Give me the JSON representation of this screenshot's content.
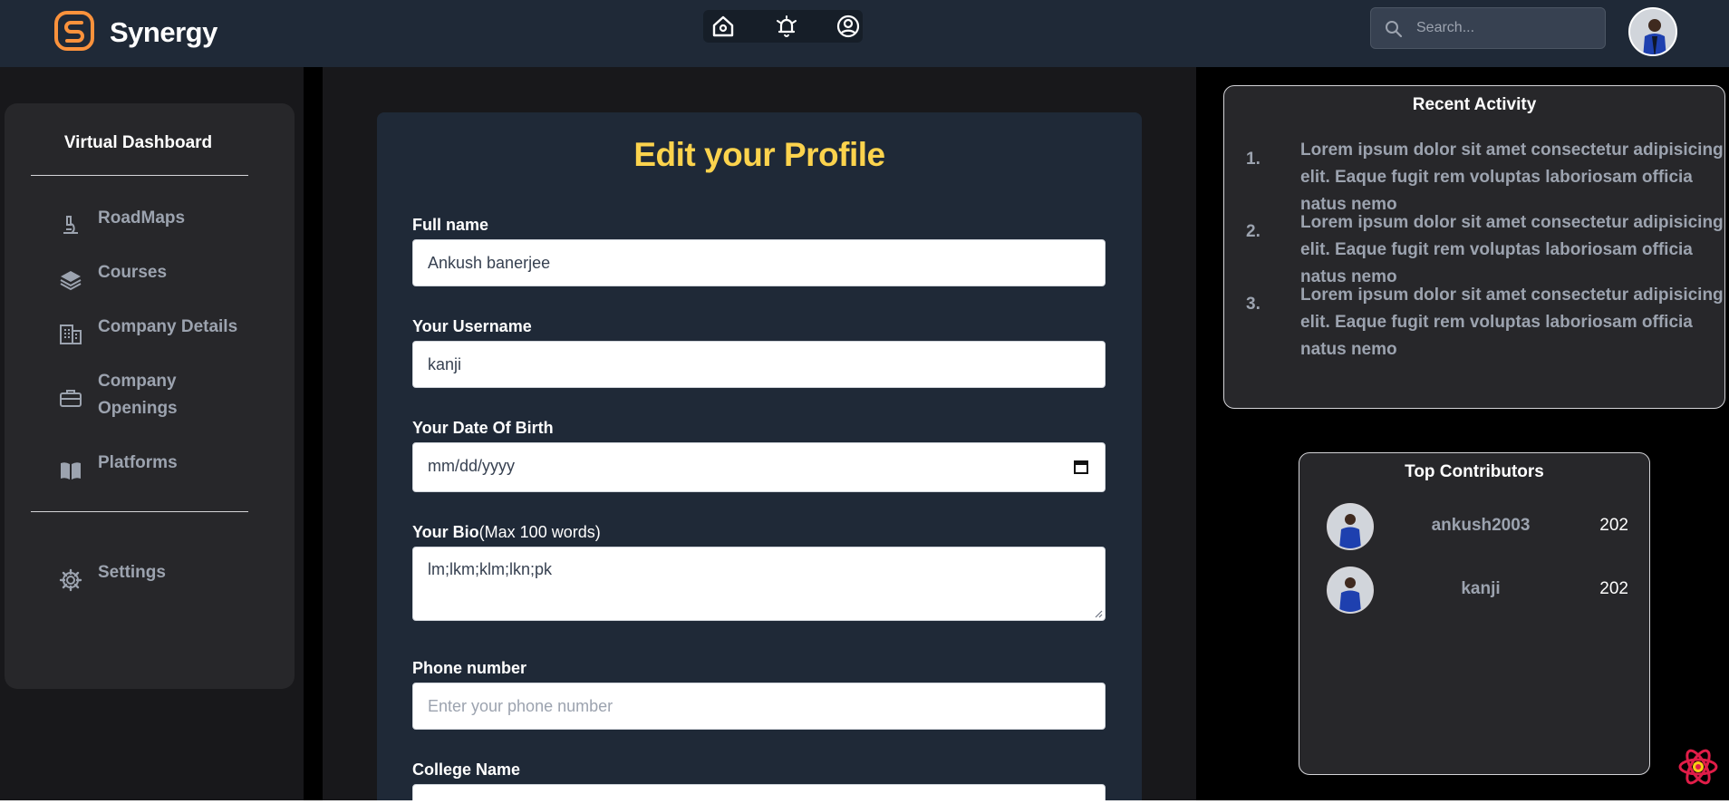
{
  "header": {
    "brand": "Synergy",
    "search_placeholder": "Search...",
    "nav": [
      "home-icon",
      "bell-icon",
      "user-icon"
    ]
  },
  "sidebar": {
    "title": "Virtual Dashboard",
    "items": [
      {
        "label": "RoadMaps",
        "icon": "microscope-icon"
      },
      {
        "label": "Courses",
        "icon": "layers-icon"
      },
      {
        "label": "Company Details",
        "icon": "building-icon"
      },
      {
        "label": "Company Openings",
        "icon": "briefcase-icon"
      },
      {
        "label": "Platforms",
        "icon": "book-icon"
      }
    ],
    "settings_label": "Settings"
  },
  "form": {
    "title": "Edit your Profile",
    "full_name_label": "Full name",
    "full_name_value": "Ankush banerjee",
    "username_label": "Your Username",
    "username_value": "kanji",
    "dob_label": "Your Date Of Birth",
    "dob_placeholder": "mm/dd/yyyy",
    "bio_label": "Your Bio",
    "bio_hint": "(Max 100 words)",
    "bio_value": "lm;lkm;klm;lkn;pk",
    "phone_label": "Phone number",
    "phone_placeholder": "Enter your phone number",
    "college_label": "College Name"
  },
  "recent_activity": {
    "title": "Recent Activity",
    "items": [
      {
        "num": "1.",
        "text": "Lorem ipsum dolor sit amet consectetur adipisicing elit. Eaque fugit rem voluptas laboriosam officia natus nemo"
      },
      {
        "num": "2.",
        "text": "Lorem ipsum dolor sit amet consectetur adipisicing elit. Eaque fugit rem voluptas laboriosam officia natus nemo"
      },
      {
        "num": "3.",
        "text": "Lorem ipsum dolor sit amet consectetur adipisicing elit. Eaque fugit rem voluptas laboriosam officia natus nemo"
      }
    ]
  },
  "top_contributors": {
    "title": "Top Contributors",
    "rows": [
      {
        "name": "ankush2003",
        "score": "202"
      },
      {
        "name": "kanji",
        "score": "202"
      }
    ]
  },
  "colors": {
    "accent_yellow": "#fcd34d",
    "brand_orange": "#fb923c",
    "header_bg": "#1f2937"
  }
}
